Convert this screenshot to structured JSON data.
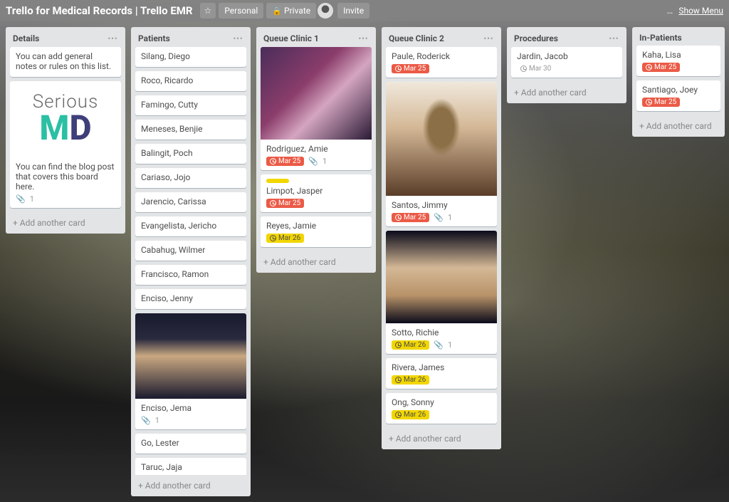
{
  "header": {
    "board_title": "Trello for Medical Records | Trello EMR",
    "star": "☆",
    "visibility_personal": "Personal",
    "visibility_private": "Private",
    "invite": "Invite",
    "show_menu": "Show Menu",
    "dots": "…"
  },
  "lists": {
    "details": {
      "title": "Details",
      "card1_text": "You can add general notes or rules on this list.",
      "card2_text": "You can find the blog post that covers this board here.",
      "card2_attach": "1",
      "add": "Add another card"
    },
    "patients": {
      "title": "Patients",
      "items": [
        "Silang, Diego",
        "Roco, Ricardo",
        "Famingo, Cutty",
        "Meneses, Benjie",
        "Balingit, Poch",
        "Cariaso, Jojo",
        "Jarencio, Carissa",
        "Evangelista, Jericho",
        "Cabahug, Wilmer",
        "Francisco, Ramon",
        "Enciso, Jenny"
      ],
      "img_card": {
        "name": "Enciso, Jema",
        "attach": "1"
      },
      "tail": [
        "Go, Lester",
        "Taruc, Jaja"
      ],
      "add": "Add another card"
    },
    "queue1": {
      "title": "Queue Clinic 1",
      "c1": {
        "name": "Rodriguez, Amie",
        "due": "Mar 25",
        "attach": "1"
      },
      "c2": {
        "name": "Limpot, Jasper",
        "due": "Mar 25"
      },
      "c3": {
        "name": "Reyes, Jamie",
        "due": "Mar 26"
      },
      "add": "Add another card"
    },
    "queue2": {
      "title": "Queue Clinic 2",
      "c1": {
        "name": "Paule, Roderick",
        "due": "Mar 25"
      },
      "c2": {
        "name": "Santos, Jimmy",
        "due": "Mar 25",
        "attach": "1"
      },
      "c3": {
        "name": "Sotto, Richie",
        "due": "Mar 26",
        "attach": "1"
      },
      "c4": {
        "name": "Rivera, James",
        "due": "Mar 26"
      },
      "c5": {
        "name": "Ong, Sonny",
        "due": "Mar 26"
      },
      "add": "Add another card"
    },
    "procedures": {
      "title": "Procedures",
      "c1": {
        "name": "Jardin, Jacob",
        "due": "Mar 30"
      },
      "add": "Add another card"
    },
    "inpatients": {
      "title": "In-Patients",
      "c1": {
        "name": "Kaha, Lisa",
        "due": "Mar 25"
      },
      "c2": {
        "name": "Santiago, Joey",
        "due": "Mar 25"
      },
      "add": "Add another card"
    }
  }
}
